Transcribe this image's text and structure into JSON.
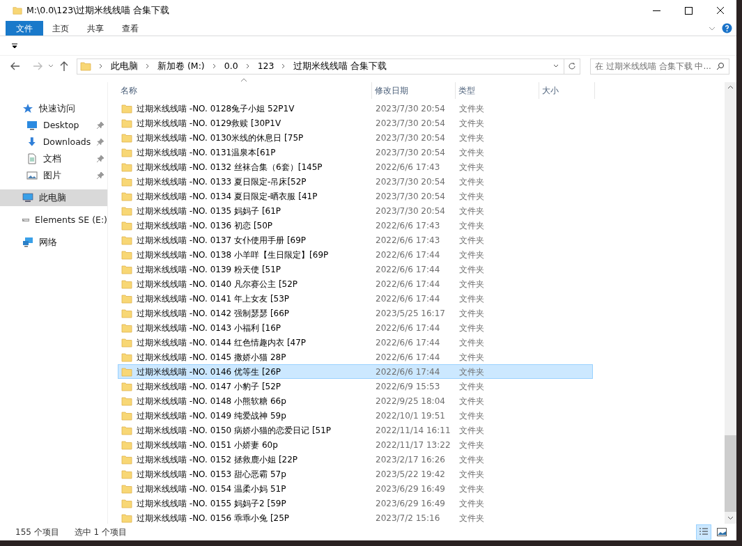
{
  "window": {
    "title": "M:\\0.0\\123\\过期米线线喵 合集下载"
  },
  "ribbon_tabs": [
    {
      "label": "文件",
      "kind": "file",
      "selected": true
    },
    {
      "label": "主页",
      "kind": "tab",
      "selected": false
    },
    {
      "label": "共享",
      "kind": "tab",
      "selected": false
    },
    {
      "label": "查看",
      "kind": "tab",
      "selected": false
    }
  ],
  "address": {
    "crumbs": [
      "此电脑",
      "新加卷 (M:)",
      "0.0",
      "123",
      "过期米线线喵 合集下载"
    ]
  },
  "search": {
    "placeholder": "在 过期米线线喵 合集下载 中..."
  },
  "sidebar": {
    "items": [
      {
        "label": "快速访问",
        "kind": "star",
        "selected": false,
        "children": [
          {
            "label": "Desktop",
            "kind": "desktop",
            "pinned": true,
            "selected": false
          },
          {
            "label": "Downloads",
            "kind": "download",
            "pinned": true,
            "selected": false
          },
          {
            "label": "文档",
            "kind": "document",
            "pinned": true,
            "selected": false
          },
          {
            "label": "图片",
            "kind": "picture",
            "pinned": true,
            "selected": false
          }
        ]
      },
      {
        "label": "此电脑",
        "kind": "computer",
        "selected": true
      },
      {
        "label": "Elements SE (E:)",
        "kind": "drive",
        "selected": false
      },
      {
        "label": "网络",
        "kind": "network",
        "selected": false
      }
    ]
  },
  "table": {
    "columns": [
      "名称",
      "修改日期",
      "类型",
      "大小"
    ],
    "rows": [
      {
        "name": "过期米线线喵 -NO. 0128兔子小姐 52P1V",
        "date": "2023/7/30 20:54",
        "type": "文件夹",
        "selected": false
      },
      {
        "name": "过期米线线喵 -NO. 0129救赎 [30P1V",
        "date": "2023/7/30 20:54",
        "type": "文件夹",
        "selected": false
      },
      {
        "name": "过期米线线喵 -NO. 0130米线的休息日 [75P",
        "date": "2023/7/30 20:54",
        "type": "文件夹",
        "selected": false
      },
      {
        "name": "过期米线线喵 -NO. 0131温泉本[61P",
        "date": "2023/7/30 20:54",
        "type": "文件夹",
        "selected": false
      },
      {
        "name": "过期米线线喵 -NO. 0132 丝袜合集（6套）[145P",
        "date": "2022/6/6 17:43",
        "type": "文件夹",
        "selected": false
      },
      {
        "name": "过期米线线喵 -NO. 0133 夏日限定-吊床[52P",
        "date": "2023/7/30 20:54",
        "type": "文件夹",
        "selected": false
      },
      {
        "name": "过期米线线喵 -NO. 0134 夏日限定-晒衣服 [41P",
        "date": "2023/7/30 20:54",
        "type": "文件夹",
        "selected": false
      },
      {
        "name": "过期米线线喵 -NO. 0135 妈妈子 [61P",
        "date": "2023/7/30 20:54",
        "type": "文件夹",
        "selected": false
      },
      {
        "name": "过期米线线喵 -NO. 0136 初恋 [50P",
        "date": "2022/6/6 17:43",
        "type": "文件夹",
        "selected": false
      },
      {
        "name": "过期米线线喵 -NO. 0137 女仆使用手册 [69P",
        "date": "2022/6/6 17:43",
        "type": "文件夹",
        "selected": false
      },
      {
        "name": "过期米线线喵 -NO. 0138 小羊咩【生日限定】[69P",
        "date": "2022/6/6 17:44",
        "type": "文件夹",
        "selected": false
      },
      {
        "name": "过期米线线喵 -NO. 0139 粉天使 [51P",
        "date": "2022/6/6 17:44",
        "type": "文件夹",
        "selected": false
      },
      {
        "name": "过期米线线喵 -NO. 0140 凡尔赛公主 [52P",
        "date": "2022/6/6 17:44",
        "type": "文件夹",
        "selected": false
      },
      {
        "name": "过期米线线喵 -NO. 0141 年上女友 [53P",
        "date": "2022/6/6 17:44",
        "type": "文件夹",
        "selected": false
      },
      {
        "name": "过期米线线喵 -NO. 0142 强制瑟瑟 [66P",
        "date": "2023/5/25 16:17",
        "type": "文件夹",
        "selected": false
      },
      {
        "name": "过期米线线喵 -NO. 0143 小福利 [16P",
        "date": "2022/6/6 17:44",
        "type": "文件夹",
        "selected": false
      },
      {
        "name": "过期米线线喵 -NO. 0144 红色情趣内衣 [47P",
        "date": "2022/6/6 17:44",
        "type": "文件夹",
        "selected": false
      },
      {
        "name": "过期米线线喵 -NO. 0145 撒娇小猫 28P",
        "date": "2022/6/6 17:44",
        "type": "文件夹",
        "selected": false
      },
      {
        "name": "过期米线线喵 -NO. 0146 优等生 [26P",
        "date": "2022/6/6 17:44",
        "type": "文件夹",
        "selected": true
      },
      {
        "name": "过期米线线喵 -NO. 0147 小豹子 [52P",
        "date": "2022/6/9 15:53",
        "type": "文件夹",
        "selected": false
      },
      {
        "name": "过期米线线喵 -NO. 0148 小熊软糖 66p",
        "date": "2022/9/25 18:04",
        "type": "文件夹",
        "selected": false
      },
      {
        "name": "过期米线线喵 -NO. 0149 纯爱战神 59p",
        "date": "2022/10/1 19:51",
        "type": "文件夹",
        "selected": false
      },
      {
        "name": "过期米线线喵 -NO. 0150 病娇小猫的恋爱日记 [51P",
        "date": "2022/11/14 16:11",
        "type": "文件夹",
        "selected": false
      },
      {
        "name": "过期米线线喵 -NO. 0151 小娇妻 60p",
        "date": "2022/11/17 13:22",
        "type": "文件夹",
        "selected": false
      },
      {
        "name": "过期米线线喵 -NO. 0152 拯救鹿小姐 [22P",
        "date": "2023/2/17 16:26",
        "type": "文件夹",
        "selected": false
      },
      {
        "name": "过期米线线喵 -NO. 0153 甜心恶霸 57p",
        "date": "2023/5/22 19:42",
        "type": "文件夹",
        "selected": false
      },
      {
        "name": "过期米线线喵 -NO. 0154 温柔小妈 51P",
        "date": "2023/6/29 16:49",
        "type": "文件夹",
        "selected": false
      },
      {
        "name": "过期米线线喵 -NO. 0155 妈妈子2 [59P",
        "date": "2023/6/29 16:49",
        "type": "文件夹",
        "selected": false
      },
      {
        "name": "过期米线线喵 -NO. 0156 乖乖小兔 [25P",
        "date": "2023/7/2 15:16",
        "type": "文件夹",
        "selected": false
      }
    ]
  },
  "status_bar": {
    "items": [
      "155 个项目",
      "选中 1 个项目"
    ]
  }
}
